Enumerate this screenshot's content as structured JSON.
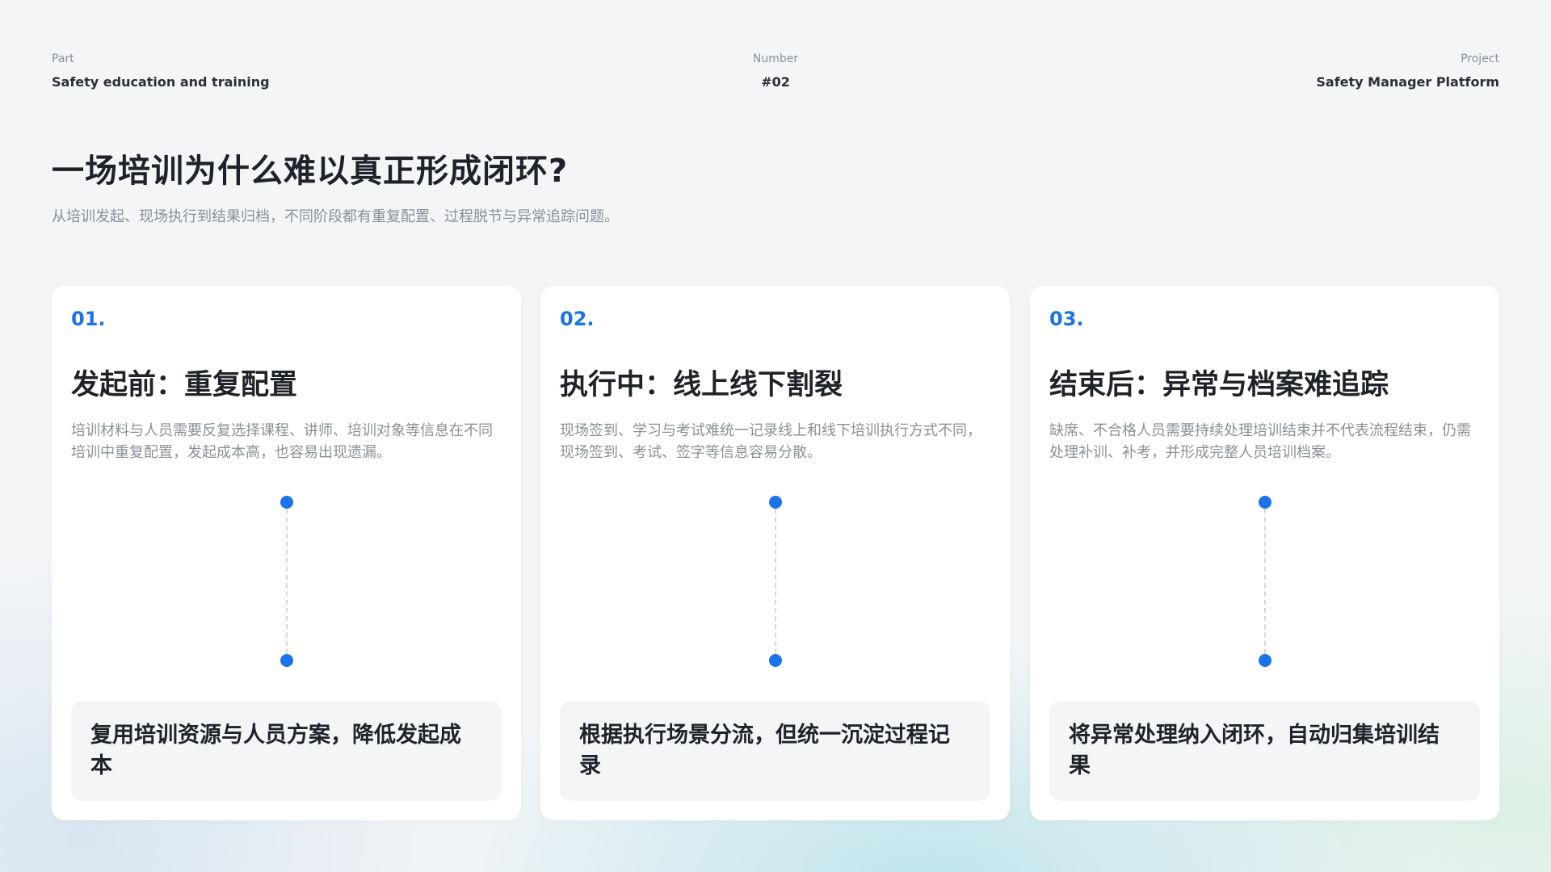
{
  "meta": {
    "part": {
      "label": "Part",
      "value": "Safety education and training"
    },
    "number": {
      "label": "Number",
      "value": "#02"
    },
    "project": {
      "label": "Project",
      "value": "Safety Manager Platform"
    }
  },
  "title": "一场培训为什么难以真正形成闭环?",
  "subtitle": "从培训发起、现场执行到结果归档，不同阶段都有重复配置、过程脱节与异常追踪问题。",
  "colors": {
    "accent": "#1a73e8",
    "text": "#1f2329",
    "muted": "#8a9099",
    "card_bg": "#ffffff",
    "panel_bg": "#f3f5f7"
  },
  "cards": [
    {
      "number": "01.",
      "title": "发起前：重复配置",
      "description": "培训材料与人员需要反复选择课程、讲师、培训对象等信息在不同培训中重复配置，发起成本高，也容易出现遗漏。",
      "solution": "复用培训资源与人员方案，降低发起成本"
    },
    {
      "number": "02.",
      "title": "执行中：线上线下割裂",
      "description": "现场签到、学习与考试难统一记录线上和线下培训执行方式不同，现场签到、考试、签字等信息容易分散。",
      "solution": "根据执行场景分流，但统一沉淀过程记录"
    },
    {
      "number": "03.",
      "title": "结束后：异常与档案难追踪",
      "description": "缺席、不合格人员需要持续处理培训结束并不代表流程结束，仍需处理补训、补考，并形成完整人员培训档案。",
      "solution": "将异常处理纳入闭环，自动归集培训结果"
    }
  ]
}
